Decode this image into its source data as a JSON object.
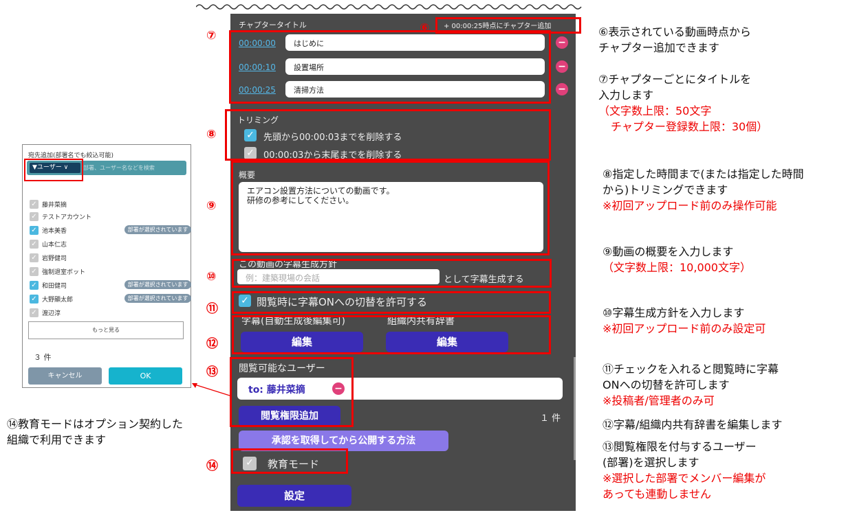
{
  "panel": {
    "chapter_title_label": "チャプタータイトル",
    "add_chapter_label": "+ 00:00:25時点にチャプター追加",
    "chapters": [
      {
        "time": "00:00:00",
        "title": "はじめに"
      },
      {
        "time": "00:00:10",
        "title": "設置場所"
      },
      {
        "time": "00:00:25",
        "title": "清掃方法"
      }
    ],
    "trimming_label": "トリミング",
    "trim_start": "先頭から00:00:03までを削除する",
    "trim_end": "00:00:03から末尾までを削除する",
    "summary_label": "概要",
    "summary_line1": "エアコン設置方法についての動画です。",
    "summary_line2": "研修の参考にしてください。",
    "caption_policy_label": "この動画の字幕生成方針",
    "caption_policy_placeholder": "例：建築現場の会話",
    "caption_policy_suffix": "として字幕生成する",
    "allow_caption_toggle": "閲覧時に字幕ONへの切替を許可する",
    "caption_edit_label": "字幕(自動生成後編集可)",
    "dictionary_label": "組織内共有辞書",
    "edit_button": "編集",
    "edit_button2": "編集",
    "viewers_label": "閲覧可能なユーザー",
    "viewer_tag": "to: 藤井菜摘",
    "add_permission_button": "閲覧権限追加",
    "viewer_count": "１ 件",
    "approval_button": "承認を取得してから公開する方法",
    "education_mode": "教育モード",
    "settings_button": "設定"
  },
  "numbers": [
    "⑥",
    "⑦",
    "⑧",
    "⑨",
    "⑩",
    "⑪",
    "⑫",
    "⑬",
    "⑭"
  ],
  "descriptions": {
    "d6a": "⑥表示されている動画時点から",
    "d6b": "チャプター追加できます",
    "d7a": "⑦チャプターごとにタイトルを",
    "d7b": "入力します",
    "d7c": "（文字数上限：50文字",
    "d7d": "チャプター登録数上限：30個）",
    "d8a": "⑧指定した時間まで(または指定した時間",
    "d8b": "から)トリミングできます",
    "d8c": "※初回アップロード前のみ操作可能",
    "d9a": "⑨動画の概要を入力します",
    "d9b": "（文字数上限：10,000文字）",
    "d10a": "⑩字幕生成方針を入力します",
    "d10b": "※初回アップロード前のみ設定可",
    "d11a": "⑪チェックを入れると閲覧時に字幕",
    "d11b": "ONへの切替を許可します",
    "d11c": "※投稿者/管理者のみ可",
    "d12": "⑫字幕/組織内共有辞書を編集します",
    "d13a": "⑬閲覧権限を付与するユーザー",
    "d13b": "(部署)を選択します",
    "d13c": "※選択した部署でメンバー編集が",
    "d13d": "あっても連動しません",
    "d14a": "⑭教育モードはオプション契約した",
    "d14b": "組織で利用できます"
  },
  "dialog": {
    "title": "宛先追加(部署名でも絞込可能)",
    "filter_label": "ユーザー",
    "search_placeholder": "部署、ユーザー名などを検索",
    "users": [
      {
        "name": "藤井菜摘",
        "checked": false,
        "badge": ""
      },
      {
        "name": "テストアカウント",
        "checked": false,
        "badge": ""
      },
      {
        "name": "池本美香",
        "checked": true,
        "badge": "部署が選択されています"
      },
      {
        "name": "山本仁志",
        "checked": false,
        "badge": ""
      },
      {
        "name": "岩野健司",
        "checked": false,
        "badge": ""
      },
      {
        "name": "強制退室ボット",
        "checked": false,
        "badge": ""
      },
      {
        "name": "和田健司",
        "checked": true,
        "badge": "部署が選択されています"
      },
      {
        "name": "大野顯太郎",
        "checked": true,
        "badge": "部署が選択されています"
      },
      {
        "name": "渡辺淳",
        "checked": false,
        "badge": ""
      }
    ],
    "more_button": "もっと見る",
    "count": "３ 件",
    "cancel_button": "キャンセル",
    "ok_button": "OK"
  },
  "colors": {
    "panel": "#4a4a4a",
    "accent_red": "#e00000",
    "button_blue": "#3a2cb5",
    "link_blue": "#55b8e8"
  }
}
